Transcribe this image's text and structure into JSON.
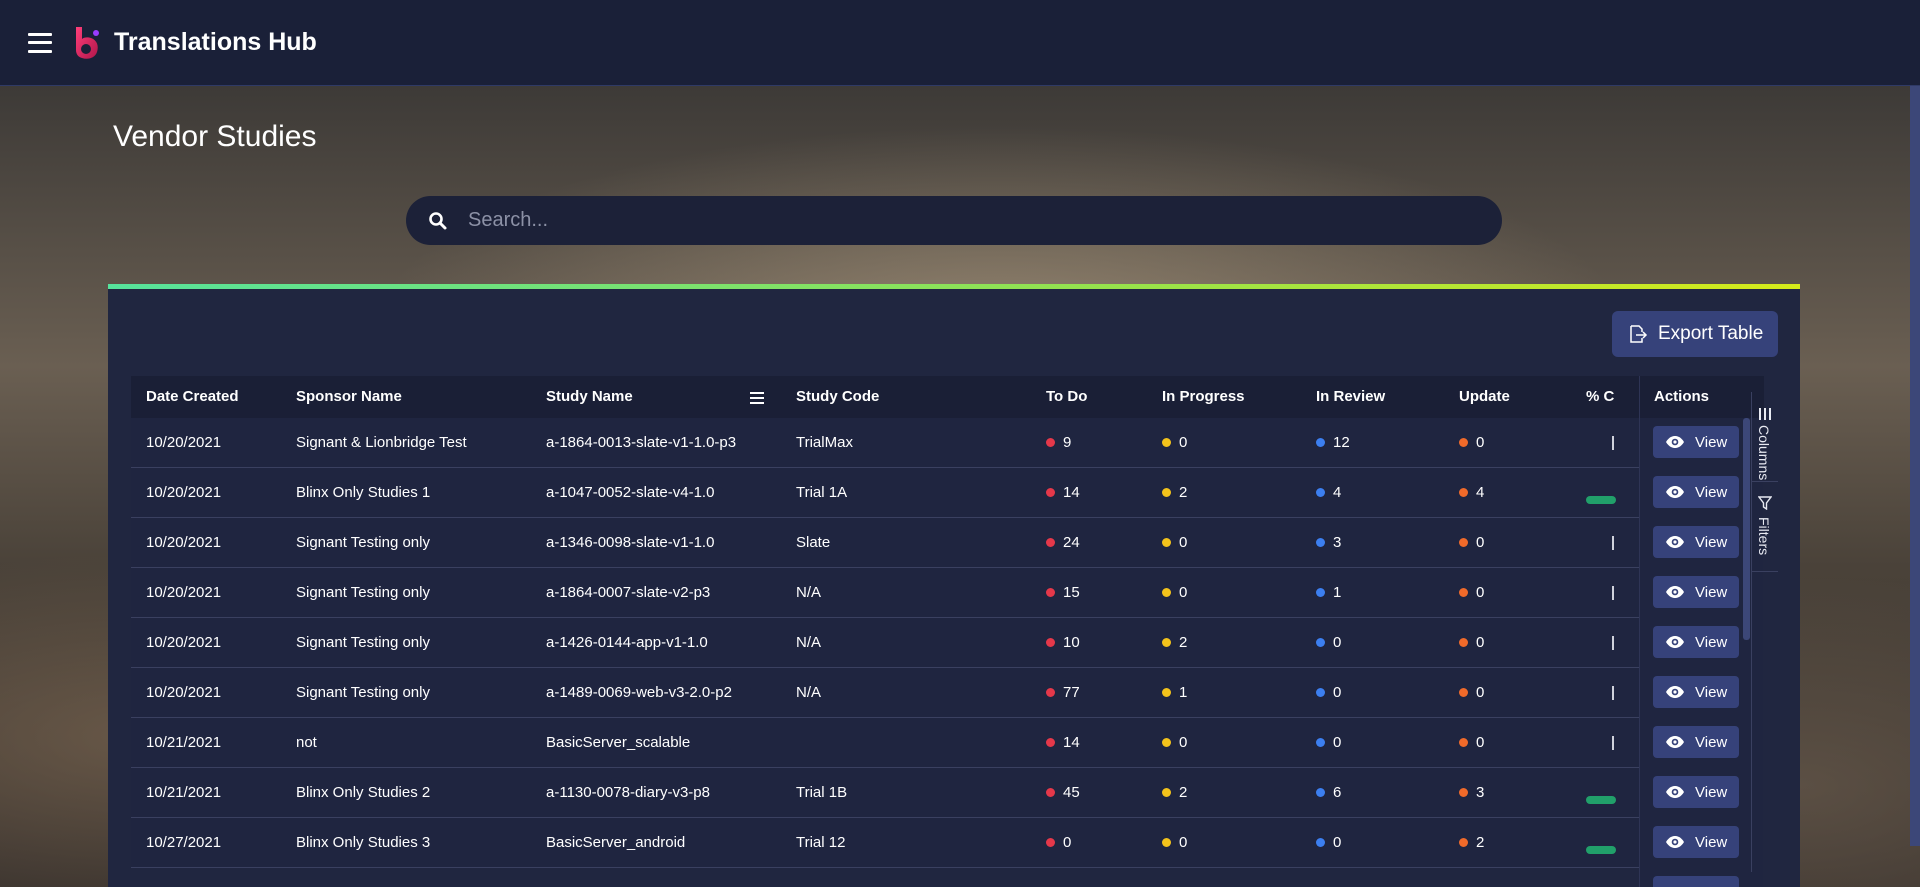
{
  "app": {
    "title": "Translations Hub"
  },
  "page": {
    "title": "Vendor Studies"
  },
  "search": {
    "placeholder": "Search..."
  },
  "toolbar": {
    "export_label": "Export Table"
  },
  "colors": {
    "topbar": "#1a2038",
    "card": "#202640",
    "button": "#36427a",
    "todo": "#e5384a",
    "in_progress": "#f2c21b",
    "in_review": "#3c7ff0",
    "update": "#f06a2a",
    "completion_bar": "#21a06a"
  },
  "table": {
    "columns": [
      "Date Created",
      "Sponsor Name",
      "Study Name",
      "Study Code",
      "To Do",
      "In Progress",
      "In Review",
      "Update",
      "% C"
    ],
    "actions_header": "Actions",
    "view_label": "View",
    "rows": [
      {
        "date": "10/20/2021",
        "sponsor": "Signant & Lionbridge Test",
        "study": "a-1864-0013-slate-v1-1.0-p3",
        "code": "TrialMax",
        "todo": "9",
        "in_progress": "0",
        "in_review": "12",
        "update": "0",
        "completion_bar": false
      },
      {
        "date": "10/20/2021",
        "sponsor": "Blinx Only Studies 1",
        "study": "a-1047-0052-slate-v4-1.0",
        "code": "Trial 1A",
        "todo": "14",
        "in_progress": "2",
        "in_review": "4",
        "update": "4",
        "completion_bar": true
      },
      {
        "date": "10/20/2021",
        "sponsor": "Signant Testing only",
        "study": "a-1346-0098-slate-v1-1.0",
        "code": "Slate",
        "todo": "24",
        "in_progress": "0",
        "in_review": "3",
        "update": "0",
        "completion_bar": false
      },
      {
        "date": "10/20/2021",
        "sponsor": "Signant Testing only",
        "study": "a-1864-0007-slate-v2-p3",
        "code": "N/A",
        "todo": "15",
        "in_progress": "0",
        "in_review": "1",
        "update": "0",
        "completion_bar": false
      },
      {
        "date": "10/20/2021",
        "sponsor": "Signant Testing only",
        "study": "a-1426-0144-app-v1-1.0",
        "code": "N/A",
        "todo": "10",
        "in_progress": "2",
        "in_review": "0",
        "update": "0",
        "completion_bar": false
      },
      {
        "date": "10/20/2021",
        "sponsor": "Signant Testing only",
        "study": "a-1489-0069-web-v3-2.0-p2",
        "code": "N/A",
        "todo": "77",
        "in_progress": "1",
        "in_review": "0",
        "update": "0",
        "completion_bar": false
      },
      {
        "date": "10/21/2021",
        "sponsor": "not",
        "study": "BasicServer_scalable",
        "code": "",
        "todo": "14",
        "in_progress": "0",
        "in_review": "0",
        "update": "0",
        "completion_bar": false
      },
      {
        "date": "10/21/2021",
        "sponsor": "Blinx Only Studies 2",
        "study": "a-1130-0078-diary-v3-p8",
        "code": "Trial 1B",
        "todo": "45",
        "in_progress": "2",
        "in_review": "6",
        "update": "3",
        "completion_bar": true
      },
      {
        "date": "10/27/2021",
        "sponsor": "Blinx Only Studies 3",
        "study": "BasicServer_android",
        "code": "Trial 12",
        "todo": "0",
        "in_progress": "0",
        "in_review": "0",
        "update": "2",
        "completion_bar": true
      }
    ]
  },
  "side_panel": {
    "columns_label": "Columns",
    "filters_label": "Filters"
  }
}
